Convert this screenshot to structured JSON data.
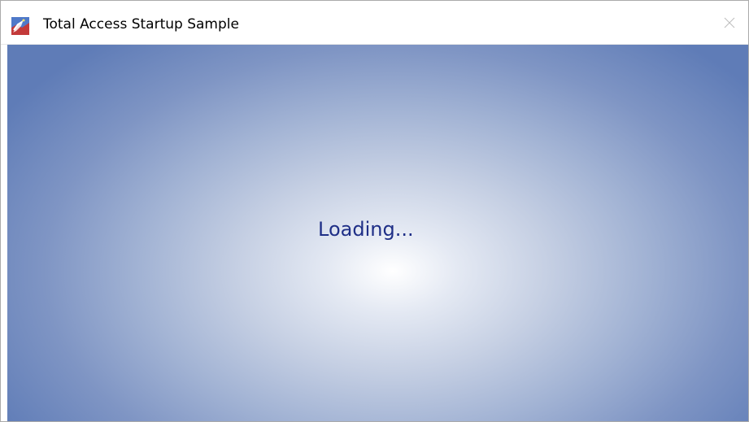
{
  "window": {
    "title": "Total Access Startup Sample",
    "app_icon": "total-access-startup-icon",
    "close_icon": "close-icon"
  },
  "content": {
    "status_text": "Loading..."
  },
  "colors": {
    "background_center": "#ffffff",
    "background_edge": "#5f7cb7",
    "status_text": "#1f2f87"
  }
}
